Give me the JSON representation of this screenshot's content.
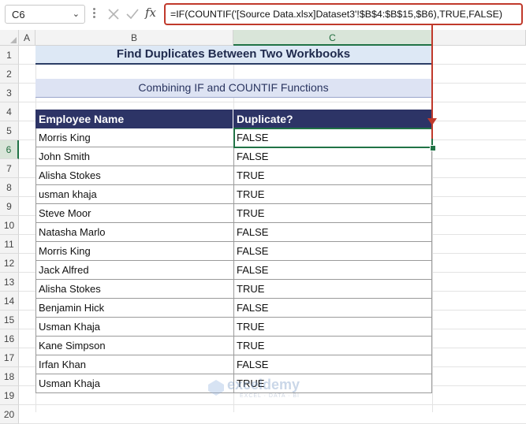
{
  "formula_bar": {
    "name_box": "C6",
    "fx_label": "fx",
    "formula": "=IF(COUNTIF('[Source Data.xlsx]Dataset3'!$B$4:$B$15,$B6),TRUE,FALSE)"
  },
  "columns": [
    "A",
    "B",
    "C"
  ],
  "rows": [
    "1",
    "2",
    "3",
    "4",
    "5",
    "6",
    "7",
    "8",
    "9",
    "10",
    "11",
    "12",
    "13",
    "14",
    "15",
    "16",
    "17",
    "18",
    "19",
    "20"
  ],
  "sheet": {
    "title": "Find Duplicates Between Two Workbooks",
    "subtitle": "Combining IF and COUNTIF Functions",
    "headers": {
      "name": "Employee Name",
      "dup": "Duplicate?"
    },
    "data_rows": [
      {
        "name": "Morris King",
        "dup": "FALSE"
      },
      {
        "name": "John Smith",
        "dup": "FALSE"
      },
      {
        "name": "Alisha Stokes",
        "dup": "TRUE"
      },
      {
        "name": "usman khaja",
        "dup": "TRUE"
      },
      {
        "name": "Steve Moor",
        "dup": "TRUE"
      },
      {
        "name": "Natasha Marlo",
        "dup": "FALSE"
      },
      {
        "name": "Morris King",
        "dup": "FALSE"
      },
      {
        "name": "Jack Alfred",
        "dup": "FALSE"
      },
      {
        "name": "Alisha Stokes",
        "dup": "TRUE"
      },
      {
        "name": "Benjamin Hick",
        "dup": "FALSE"
      },
      {
        "name": "Usman Khaja",
        "dup": "TRUE"
      },
      {
        "name": "Kane Simpson",
        "dup": "TRUE"
      },
      {
        "name": "Irfan Khan",
        "dup": "FALSE"
      },
      {
        "name": "Usman Khaja",
        "dup": "TRUE"
      }
    ]
  },
  "watermark": {
    "name": "exceldemy",
    "tagline": "EXCEL · DATA · BI"
  },
  "colors": {
    "header_fill": "#2d3466",
    "selection": "#217346",
    "annotation": "#c0392b"
  }
}
